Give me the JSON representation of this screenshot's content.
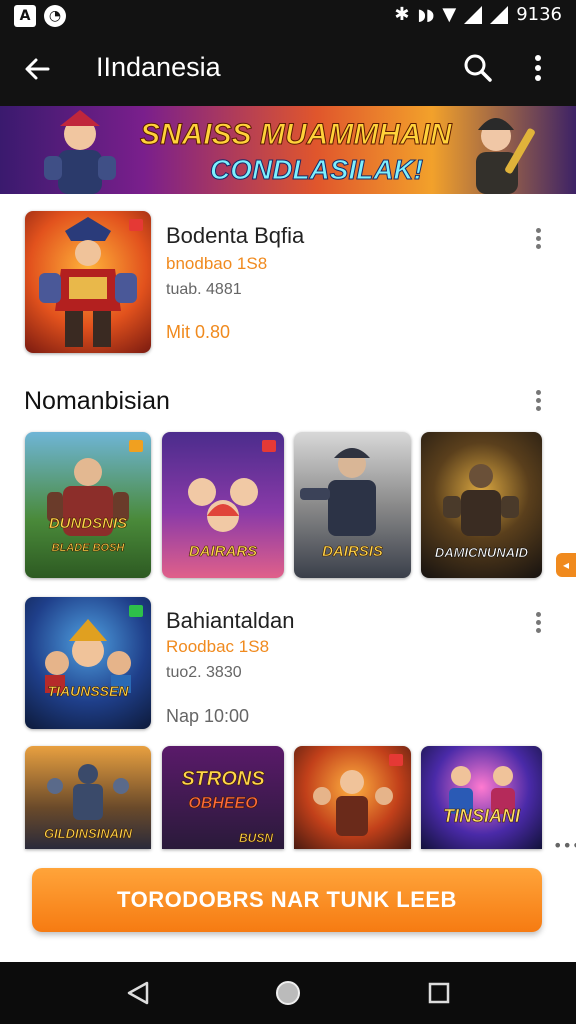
{
  "status_bar": {
    "left_icons": [
      "app-a-icon",
      "app-b-icon"
    ],
    "time": "9136"
  },
  "app_bar": {
    "title": "IIndanesia",
    "back_icon": "arrow-left-icon",
    "search_icon": "search-icon",
    "more_icon": "more-vert-icon"
  },
  "banner": {
    "line1": "SNAISS MUAMMHAIN",
    "line2": "CONDLASILAK!"
  },
  "featured": {
    "title": "Bodenta Bqfia",
    "subtitle": "bnodbao 1S8",
    "meta": "tuab. 4881",
    "price": "Mit 0.80"
  },
  "section": {
    "title": "Nomanbisian",
    "tiles": [
      {
        "label": "DUNDSNIS",
        "sub": "BLADE BOSH"
      },
      {
        "label": "DAIRARS",
        "sub": ""
      },
      {
        "label": "DAIRSIS",
        "sub": ""
      },
      {
        "label": "DAMICNUNAID",
        "sub": ""
      }
    ]
  },
  "second_item": {
    "title": "Bahiantaldan",
    "subtitle": "Roodbac 1S8",
    "meta": "tuo2. 3830",
    "price": "Nap 10:00",
    "thumb_label": "TIAUNSSEN"
  },
  "bottom_tiles": [
    {
      "label": "GILDINSINAIN"
    },
    {
      "label": "STRONS",
      "sub": "OBHEEO",
      "corner": "BUSN"
    },
    {
      "label": ""
    },
    {
      "label": "TINSIANI"
    }
  ],
  "cta": {
    "label": "TORODOBRS NAR TUNK LEEB"
  },
  "nav": {
    "back": "nav-back-icon",
    "home": "nav-home-icon",
    "recents": "nav-recents-icon"
  },
  "colors": {
    "accent": "#f08a1e",
    "bar_bg": "#121212",
    "cta_top": "#ffa43a",
    "cta_bottom": "#f67b12"
  }
}
